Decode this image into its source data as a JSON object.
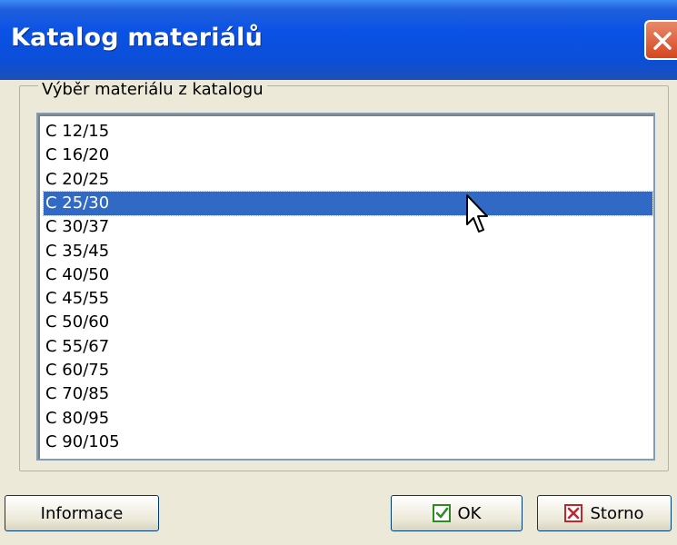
{
  "window": {
    "title": "Katalog materiálů"
  },
  "group": {
    "label": "Výběr materiálu z katalogu"
  },
  "materials": [
    "C 12/15",
    "C 16/20",
    "C 20/25",
    "C 25/30",
    "C 30/37",
    "C 35/45",
    "C 40/50",
    "C 45/55",
    "C 50/60",
    "C 55/67",
    "C 60/75",
    "C 70/85",
    "C 80/95",
    "C 90/105"
  ],
  "selected_material": "C 25/30",
  "buttons": {
    "info": "Informace",
    "ok": "OK",
    "cancel": "Storno"
  },
  "colors": {
    "selection": "#316ac5",
    "titlebar": "#0a52e6",
    "ok_icon": "#2e8b23",
    "cancel_icon": "#c0272d"
  },
  "icons": {
    "close": "close-icon",
    "ok": "checkmark-icon",
    "cancel": "cross-icon",
    "cursor": "mouse-pointer-icon"
  }
}
